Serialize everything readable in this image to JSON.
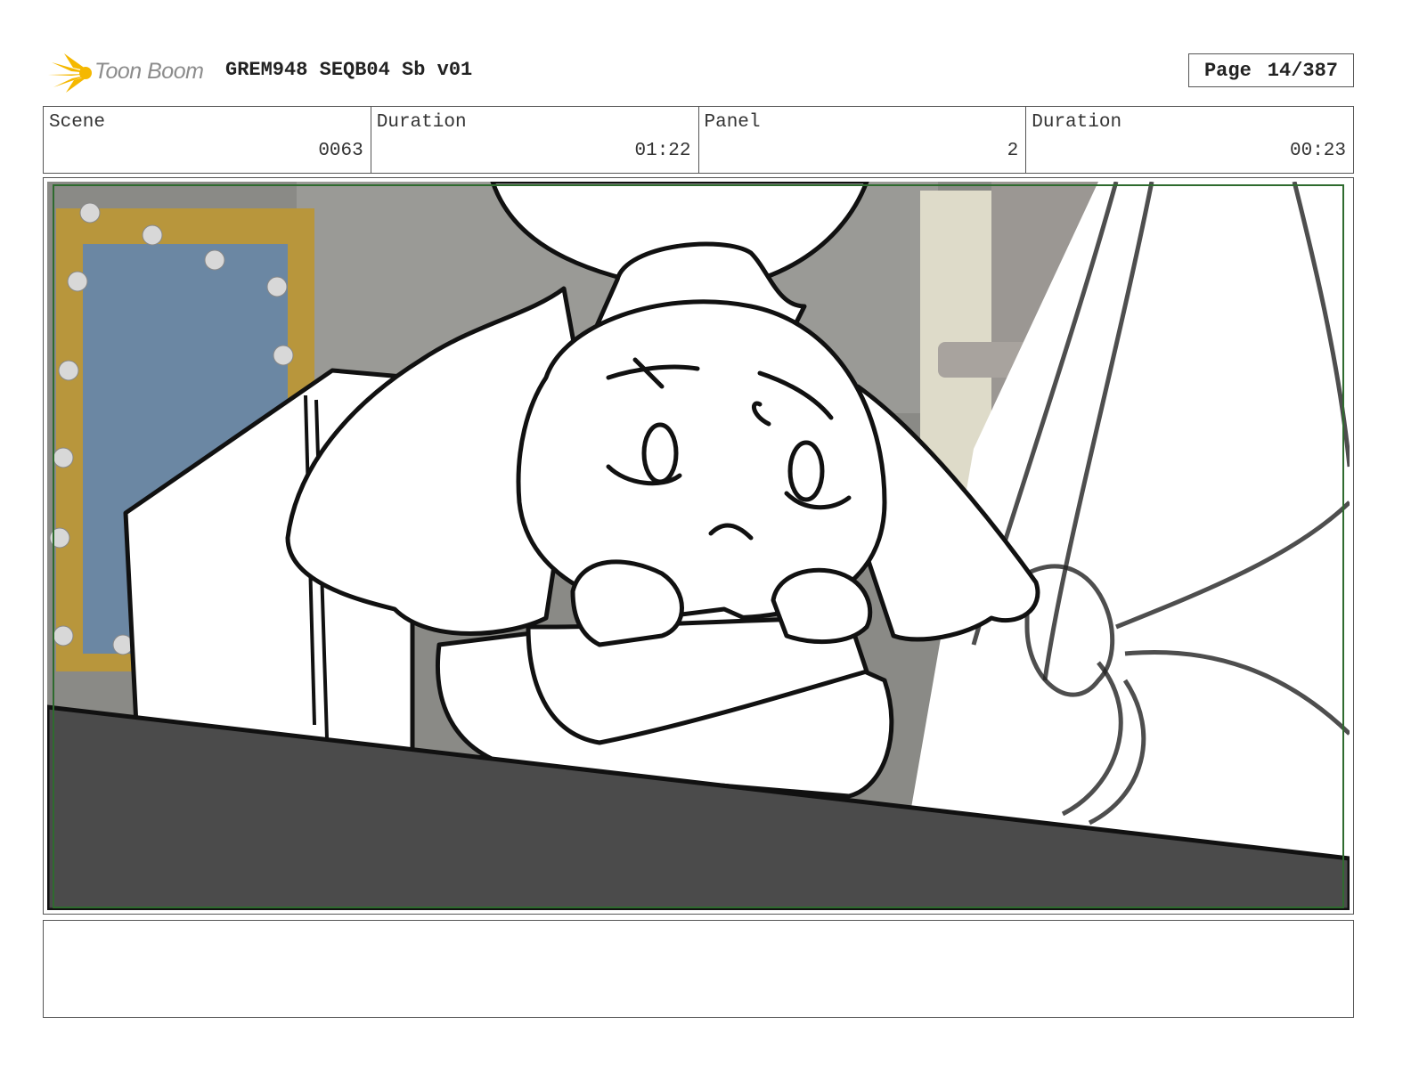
{
  "header": {
    "logo_text": "Toon Boom",
    "doc_title": "GREM948 SEQB04 Sb v01",
    "page_label": "Page",
    "page_number": "14/387"
  },
  "info": {
    "scene_label": "Scene",
    "scene_value": "0063",
    "duration_label": "Duration",
    "duration_value": "01:22",
    "panel_label": "Panel",
    "panel_value": "2",
    "panel_duration_label": "Duration",
    "panel_duration_value": "00:23"
  },
  "notes": {
    "text": ""
  },
  "colors": {
    "logo_yellow": "#f5b800",
    "safe_frame": "#2e6b2e",
    "counter": "#4b4b4b",
    "mirror_frame": "#b8963c",
    "mirror_glass": "#6b87a3",
    "background_wall": "#8a8a86"
  }
}
